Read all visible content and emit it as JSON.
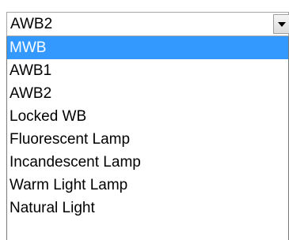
{
  "select": {
    "value": "AWB2",
    "arrow_icon": "chevron-down-icon"
  },
  "options": [
    {
      "label": "MWB",
      "highlighted": true
    },
    {
      "label": "AWB1",
      "highlighted": false
    },
    {
      "label": "AWB2",
      "highlighted": false
    },
    {
      "label": "Locked WB",
      "highlighted": false
    },
    {
      "label": "Fluorescent Lamp",
      "highlighted": false
    },
    {
      "label": "Incandescent Lamp",
      "highlighted": false
    },
    {
      "label": "Warm Light Lamp",
      "highlighted": false
    },
    {
      "label": "Natural Light",
      "highlighted": false
    }
  ],
  "colors": {
    "highlight": "#3399ff",
    "highlight_text": "#ffffff",
    "text": "#000000",
    "background": "#ffffff"
  }
}
